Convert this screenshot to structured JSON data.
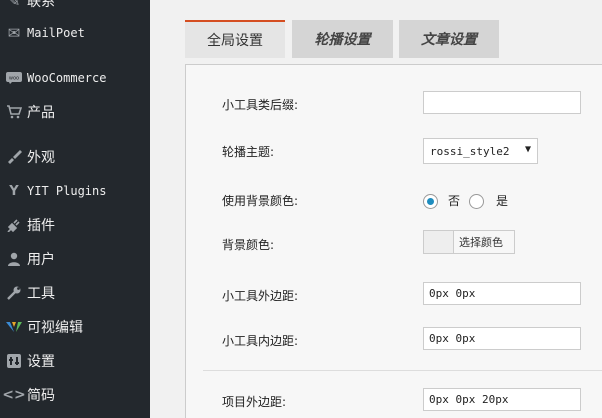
{
  "sidebar": {
    "items": [
      {
        "icon": "comments-icon",
        "label": "联系"
      },
      {
        "icon": "mail-icon",
        "label": "MailPoet"
      },
      {
        "icon": "woo-icon",
        "label": "WooCommerce"
      },
      {
        "icon": "cart-icon",
        "label": "产品"
      },
      {
        "icon": "brush-icon",
        "label": "外观"
      },
      {
        "icon": "yit-icon",
        "label": "YIT Plugins"
      },
      {
        "icon": "plugin-icon",
        "label": "插件"
      },
      {
        "icon": "user-icon",
        "label": "用户"
      },
      {
        "icon": "wrench-icon",
        "label": "工具"
      },
      {
        "icon": "visual-editor-icon",
        "label": "可视编辑"
      },
      {
        "icon": "settings-icon",
        "label": "设置"
      },
      {
        "icon": "code-icon",
        "label": "简码"
      }
    ]
  },
  "tabs": [
    {
      "label": "全局设置",
      "active": true
    },
    {
      "label": "轮播设置",
      "active": false
    },
    {
      "label": "文章设置",
      "active": false
    }
  ],
  "fields": {
    "suffix_label": "小工具类后缀:",
    "suffix_value": "",
    "theme_label": "轮播主题:",
    "theme_value": "rossi_style2",
    "use_bg_label": "使用背景颜色:",
    "use_bg_no": "否",
    "use_bg_yes": "是",
    "use_bg_selected": "否",
    "bg_color_label": "背景颜色:",
    "bg_color_button": "选择颜色",
    "outer_margin_label": "小工具外边距:",
    "outer_margin_value": "0px 0px",
    "inner_padding_label": "小工具内边距:",
    "inner_padding_value": "0px 0px",
    "item_margin_label": "项目外边距:",
    "item_margin_value": "0px 0px 20px"
  },
  "colors": {
    "sidebar_bg": "#23282d",
    "tab_accent": "#d54e21",
    "radio_checked": "#1e8cbe"
  }
}
